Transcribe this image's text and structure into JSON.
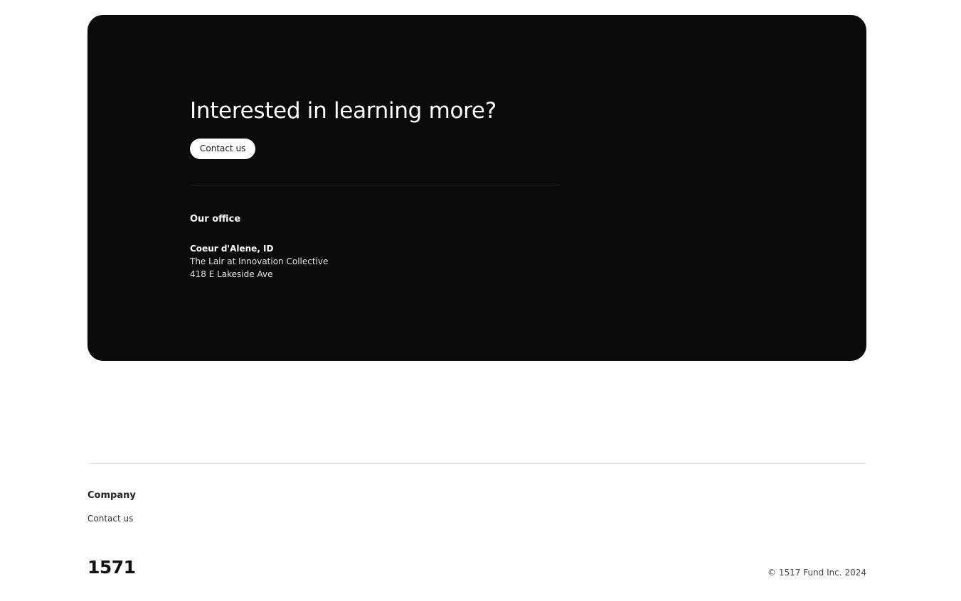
{
  "cta": {
    "heading": "Interested in learning more?",
    "button_label": "Contact us",
    "office": {
      "title": "Our office",
      "city": "Coeur d'Alene, ID",
      "address_line1": "The Lair at Innovation Collective",
      "address_line2": "418 E Lakeside Ave"
    },
    "colors": {
      "card_background": "#0b0b0b",
      "button_background": "#ffffff"
    }
  },
  "footer": {
    "section_heading": "Company",
    "links": [
      "Contact us"
    ],
    "logo_text": "1571",
    "copyright": "© 1517 Fund Inc. 2024"
  }
}
